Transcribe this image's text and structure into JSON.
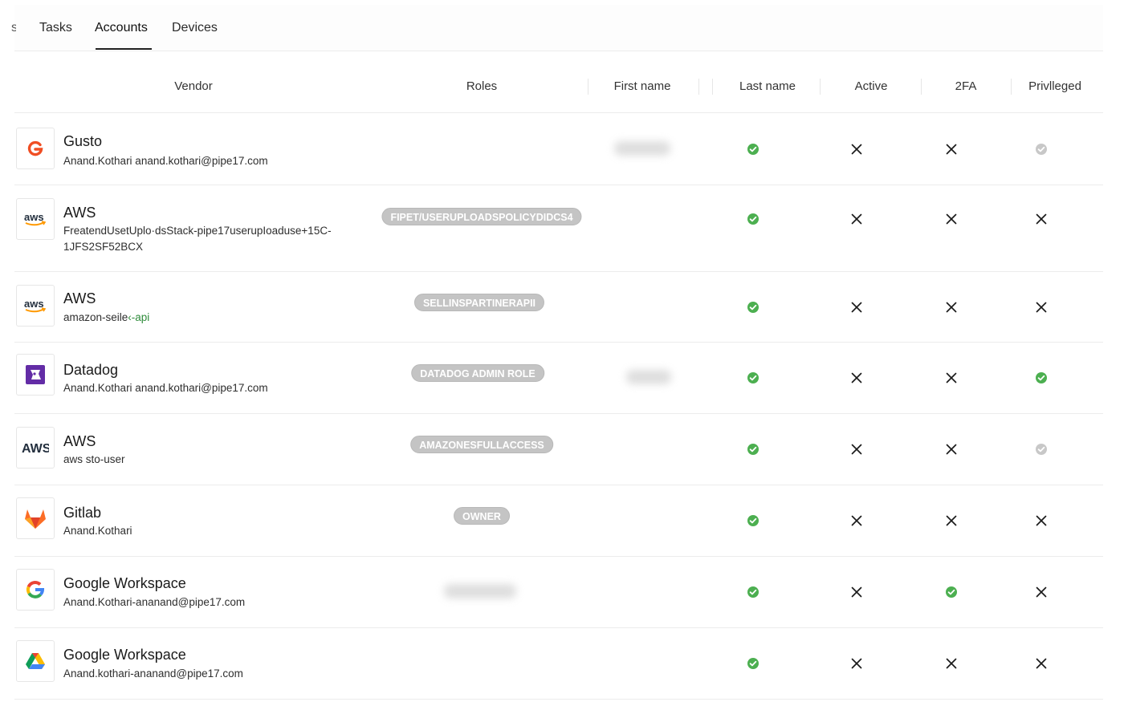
{
  "tabs": [
    {
      "label": "s"
    },
    {
      "label": "Tasks"
    },
    {
      "label": "Accounts"
    },
    {
      "label": "Devices"
    }
  ],
  "active_tab": "Accounts",
  "columns": {
    "vendor": "Vendor",
    "roles": "Roles",
    "first_name": "First name",
    "last_name": "Last name",
    "active": "Active",
    "twofa": "2FA",
    "privileged": "Privlleged"
  },
  "colors": {
    "check_green": "#4caf50",
    "check_grey": "#c8c8c8",
    "pill_bg": "#c4c4c4"
  },
  "rows": [
    {
      "vendor": "Gusto",
      "sub": "Anand.Kothari anand.kothari@pipe17.com",
      "sub_extra": "",
      "logo": "gusto-logo",
      "role": "",
      "last_name": "check",
      "active": "x",
      "twofa": "x",
      "privileged": "grey-check"
    },
    {
      "vendor": "AWS",
      "sub": "FreatendUsetUplo·dsStack-pipe17userupIoaduse+15C-1JFS2SF52BCX",
      "sub_extra": "",
      "logo": "aws-logo",
      "role": "FIPET/USERUPLOADSPOLICYDIDCS4",
      "last_name": "check",
      "active": "x",
      "twofa": "x",
      "privileged": "x"
    },
    {
      "vendor": "AWS",
      "sub": "amazon-seile",
      "sub_extra": "‹-api",
      "logo": "aws-logo",
      "role": "SELLINSPARTINERAPII",
      "last_name": "check",
      "active": "x",
      "twofa": "x",
      "privileged": "x"
    },
    {
      "vendor": "Datadog",
      "sub": "Anand.Kothari anand.kothari@pipe17.com",
      "sub_extra": "",
      "logo": "datadog-logo",
      "role": "DATADOG ADMIN ROLE",
      "last_name": "check",
      "active": "x",
      "twofa": "x",
      "privileged": "check"
    },
    {
      "vendor": "AWS",
      "sub": "aws sto-user",
      "sub_extra": "",
      "logo": "aws-bold-logo",
      "role": "AMAZONESFULLACCESS",
      "last_name": "check",
      "active": "x",
      "twofa": "x",
      "privileged": "grey-check"
    },
    {
      "vendor": "Gitlab",
      "sub": "Anand.Kothari",
      "sub_extra": "",
      "logo": "gitlab-logo",
      "role": "OWNER",
      "last_name": "check",
      "active": "x",
      "twofa": "x",
      "privileged": "x"
    },
    {
      "vendor": "Google Workspace",
      "sub": "Anand.Kothari-ananand@pipe17.com",
      "sub_extra": "",
      "logo": "google-logo",
      "role": "",
      "last_name": "check",
      "active": "x",
      "twofa": "check",
      "privileged": "x"
    },
    {
      "vendor": "Google Workspace",
      "sub": "Anand.kothari-ananand@pipe17.com",
      "sub_extra": "",
      "logo": "google-drive-logo",
      "role": "",
      "last_name": "check",
      "active": "x",
      "twofa": "x",
      "privileged": "x"
    }
  ]
}
